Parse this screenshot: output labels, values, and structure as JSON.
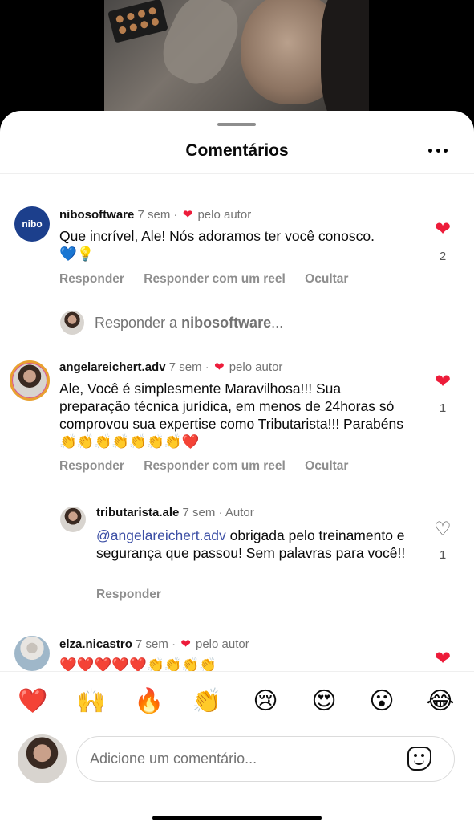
{
  "sheet": {
    "title": "Comentários"
  },
  "comments": [
    {
      "user": "nibosoftware",
      "time": "7 sem",
      "tag": "pelo autor",
      "text": "Que incrível, Ale! Nós adoramos ter você conosco. 💙💡",
      "likes": "2",
      "actions": {
        "reply": "Responder",
        "reel": "Responder com um reel",
        "hide": "Ocultar"
      },
      "avatar_label": "nibo"
    },
    {
      "user": "angelareichert.adv",
      "time": "7 sem",
      "tag": "pelo autor",
      "text": "Ale, Você é  simplesmente Maravilhosa!!! Sua preparação técnica jurídica, em menos de 24horas só comprovou sua expertise como Tributarista!!! Parabéns 👏👏👏👏👏👏👏❤️",
      "likes": "1",
      "actions": {
        "reply": "Responder",
        "reel": "Responder com um reel",
        "hide": "Ocultar"
      }
    },
    {
      "user": "elza.nicastro",
      "time": "7 sem",
      "tag": "pelo autor",
      "text": "❤️❤️❤️❤️❤️👏👏👏👏"
    }
  ],
  "reply_prompt": {
    "prefix": "Responder a ",
    "user": "nibosoftware",
    "suffix": "..."
  },
  "reply": {
    "user": "tributarista.ale",
    "time": "7 sem",
    "role": "Autor",
    "mention": "@angelareichert.adv",
    "text": " obrigada pelo treinamento e segurança que passou! Sem palavras para você!!",
    "likes": "1",
    "action": "Responder"
  },
  "emoji_bar": [
    "❤️",
    "🙌",
    "🔥",
    "👏",
    "😢",
    "😍",
    "😮",
    "😂"
  ],
  "input": {
    "placeholder": "Adicione um comentário..."
  },
  "icons": [
    "more-icon",
    "heart-icon",
    "sticker-icon"
  ],
  "colors": {
    "like": "#ed1c3a",
    "mention": "#3c4fa5",
    "muted": "#737373"
  }
}
